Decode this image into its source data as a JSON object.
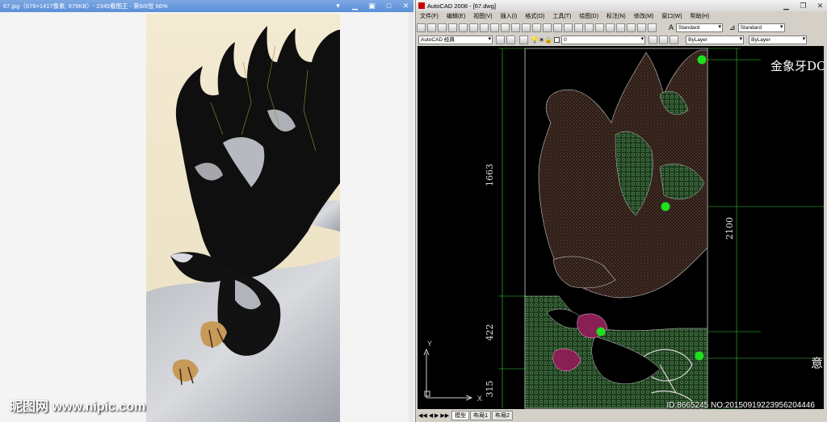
{
  "viewer": {
    "title": "67.jpg（679×1417像素, 979KB）- 2345看图王 - 第8/8张 66%"
  },
  "cad": {
    "title": "AutoCAD 2008 - [67.dwg]",
    "menu": [
      "文件(F)",
      "编辑(E)",
      "视图(V)",
      "插入(I)",
      "格式(O)",
      "工具(T)",
      "绘图(D)",
      "标注(N)",
      "修改(M)",
      "窗口(W)",
      "帮助(H)"
    ],
    "workspace": "AutoCAD 经典",
    "layer": "0",
    "text_style": "Standard",
    "dim_style": "Standard",
    "color": "ByLayer",
    "linetype": "ByLayer",
    "dims": {
      "total": "2100",
      "upper": "1663",
      "middle": "422",
      "lower": "315"
    },
    "label_top": "金象牙DC",
    "label_bottom": "意",
    "ucs_x": "X",
    "ucs_y": "Y",
    "layout_tabs": [
      "模型",
      "布局1",
      "布局2"
    ]
  },
  "watermark": "昵图网 www.nipic.com",
  "id_watermark": "ID:8665245 NO:20150919223956204446"
}
